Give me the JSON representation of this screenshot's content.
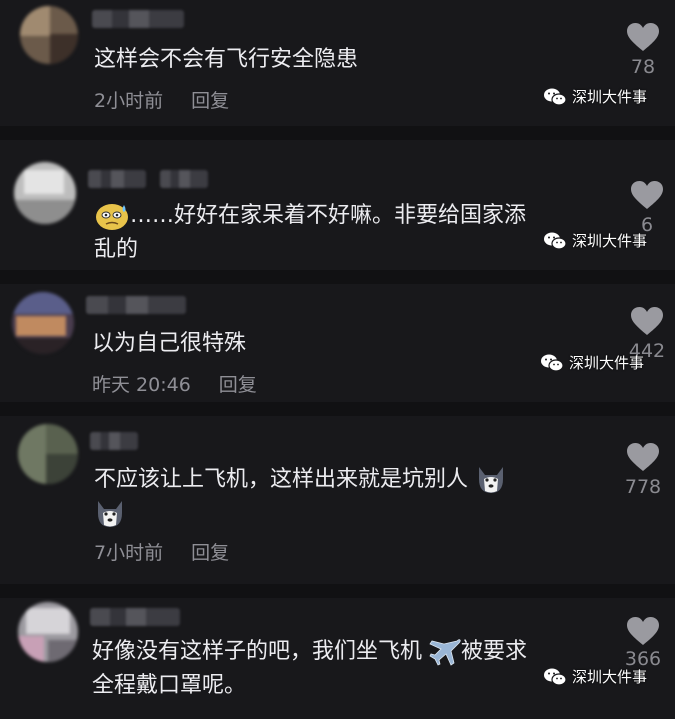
{
  "watermark": "深圳大件事",
  "comments": [
    {
      "text_lines": [
        "这样会不会有飞行安全隐患"
      ],
      "time": "2小时前",
      "reply": "回复",
      "likes": "78"
    },
    {
      "text_lines": [
        "……好好在家呆着不好嘛。非要给国家添",
        "乱的"
      ],
      "time": "",
      "reply": "",
      "likes": "6"
    },
    {
      "text_lines": [
        "以为自己很特殊"
      ],
      "time": "昨天 20:46",
      "reply": "回复",
      "likes": "442"
    },
    {
      "text_lines": [
        "不应该让上飞机，这样出来就是坑别人",
        ""
      ],
      "time": "7小时前",
      "reply": "回复",
      "likes": "778"
    },
    {
      "text_lines": [
        "好像没有这样子的吧，我们坐飞机",
        "全程戴口罩呢。"
      ],
      "text_after_icon": "被要求",
      "time": "",
      "reply": "",
      "likes": "366"
    }
  ],
  "icons": {
    "like": "heart-icon",
    "wechat": "wechat-icon",
    "emoji_sweat": "sweat-face-emoji",
    "emoji_dog": "husky-emoji",
    "emoji_plane": "airplane-emoji"
  }
}
